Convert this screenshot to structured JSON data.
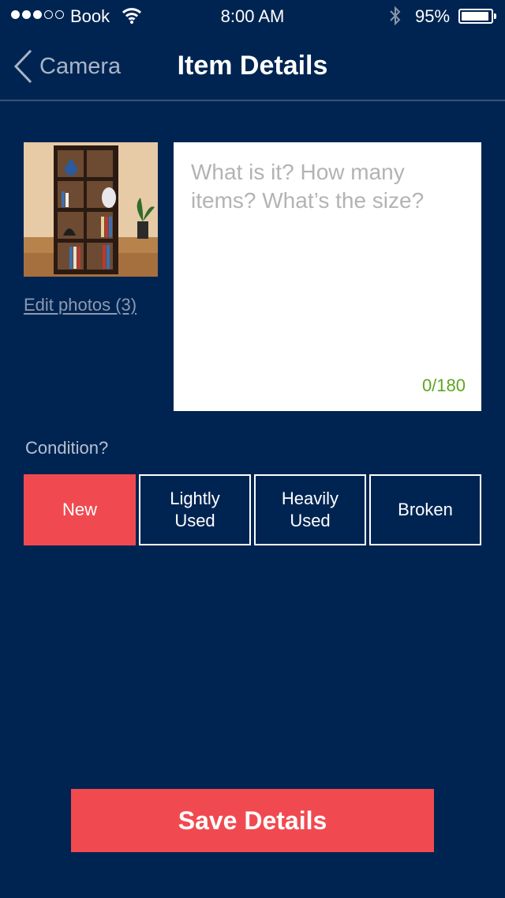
{
  "status_bar": {
    "carrier": "Book",
    "time": "8:00 AM",
    "battery_percent": "95%",
    "signal_bars_filled": 3,
    "signal_bars_total": 5,
    "battery_level": 0.95
  },
  "nav": {
    "back_label": "Camera",
    "title": "Item Details"
  },
  "photo": {
    "alt": "bookshelf",
    "edit_label": "Edit photos (3)"
  },
  "description": {
    "placeholder": "What is it? How many items? What’s the size?",
    "value": "",
    "counter": "0/180"
  },
  "condition": {
    "label": "Condition?",
    "options": [
      "New",
      "Lightly\nUsed",
      "Heavily\nUsed",
      "Broken"
    ],
    "selected_index": 0
  },
  "save_label": "Save Details",
  "colors": {
    "background": "#002451",
    "accent": "#f04a50",
    "counter": "#5ea61e",
    "muted_text": "#8c9ab0"
  },
  "icons": [
    "signal-dots-icon",
    "wifi-icon",
    "bluetooth-icon",
    "battery-icon",
    "chevron-left-icon"
  ]
}
